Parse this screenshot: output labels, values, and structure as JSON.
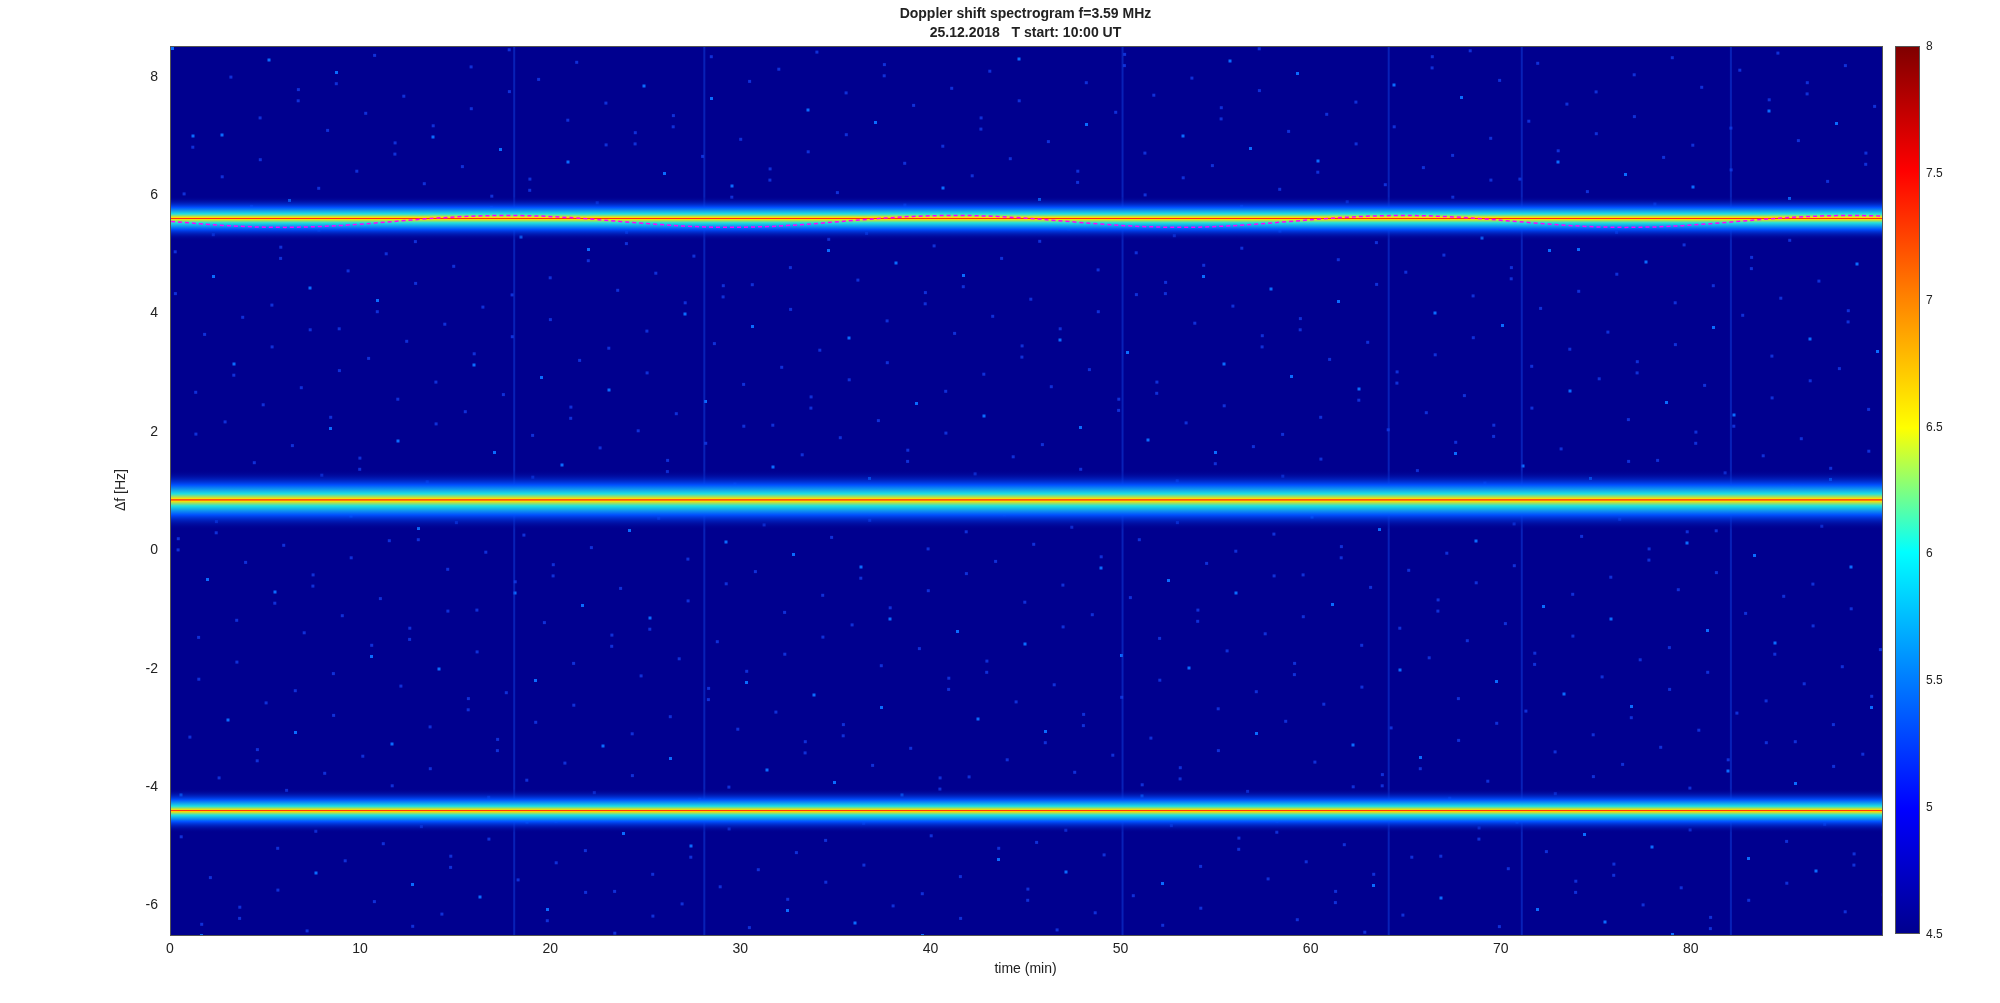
{
  "figure": {
    "title_lines": [
      "Doppler shift spectrogram f=3.59 MHz",
      "25.12.2018   T start: 10:00 UT"
    ],
    "ylabel": "Δf [Hz]",
    "xlabel": "time (min)",
    "yticks": [
      "8",
      "6",
      "4",
      "2",
      "0",
      "-2",
      "-4",
      "-6"
    ],
    "xticks": [
      "0",
      "10",
      "20",
      "30",
      "40",
      "50",
      "60",
      "70",
      "80"
    ],
    "colorbar_ticks": [
      "8",
      "7.5",
      "7",
      "6.5",
      "6",
      "5.5",
      "5",
      "4.5"
    ]
  }
}
